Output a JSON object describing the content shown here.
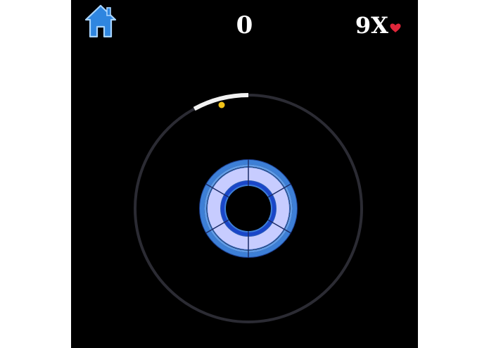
{
  "hud": {
    "home_icon": "home-icon",
    "score": "0",
    "lives": "9X",
    "lives_icon": "heart-icon"
  },
  "colors": {
    "background": "#000000",
    "track": "#2b2b33",
    "paddle": "#f2f2f2",
    "ball": "#f2c318",
    "ring_outer": "#3d7fd6",
    "ring_light": "#c7ccff",
    "ring_inner": "#1a46c9",
    "heart": "#e0263a"
  }
}
